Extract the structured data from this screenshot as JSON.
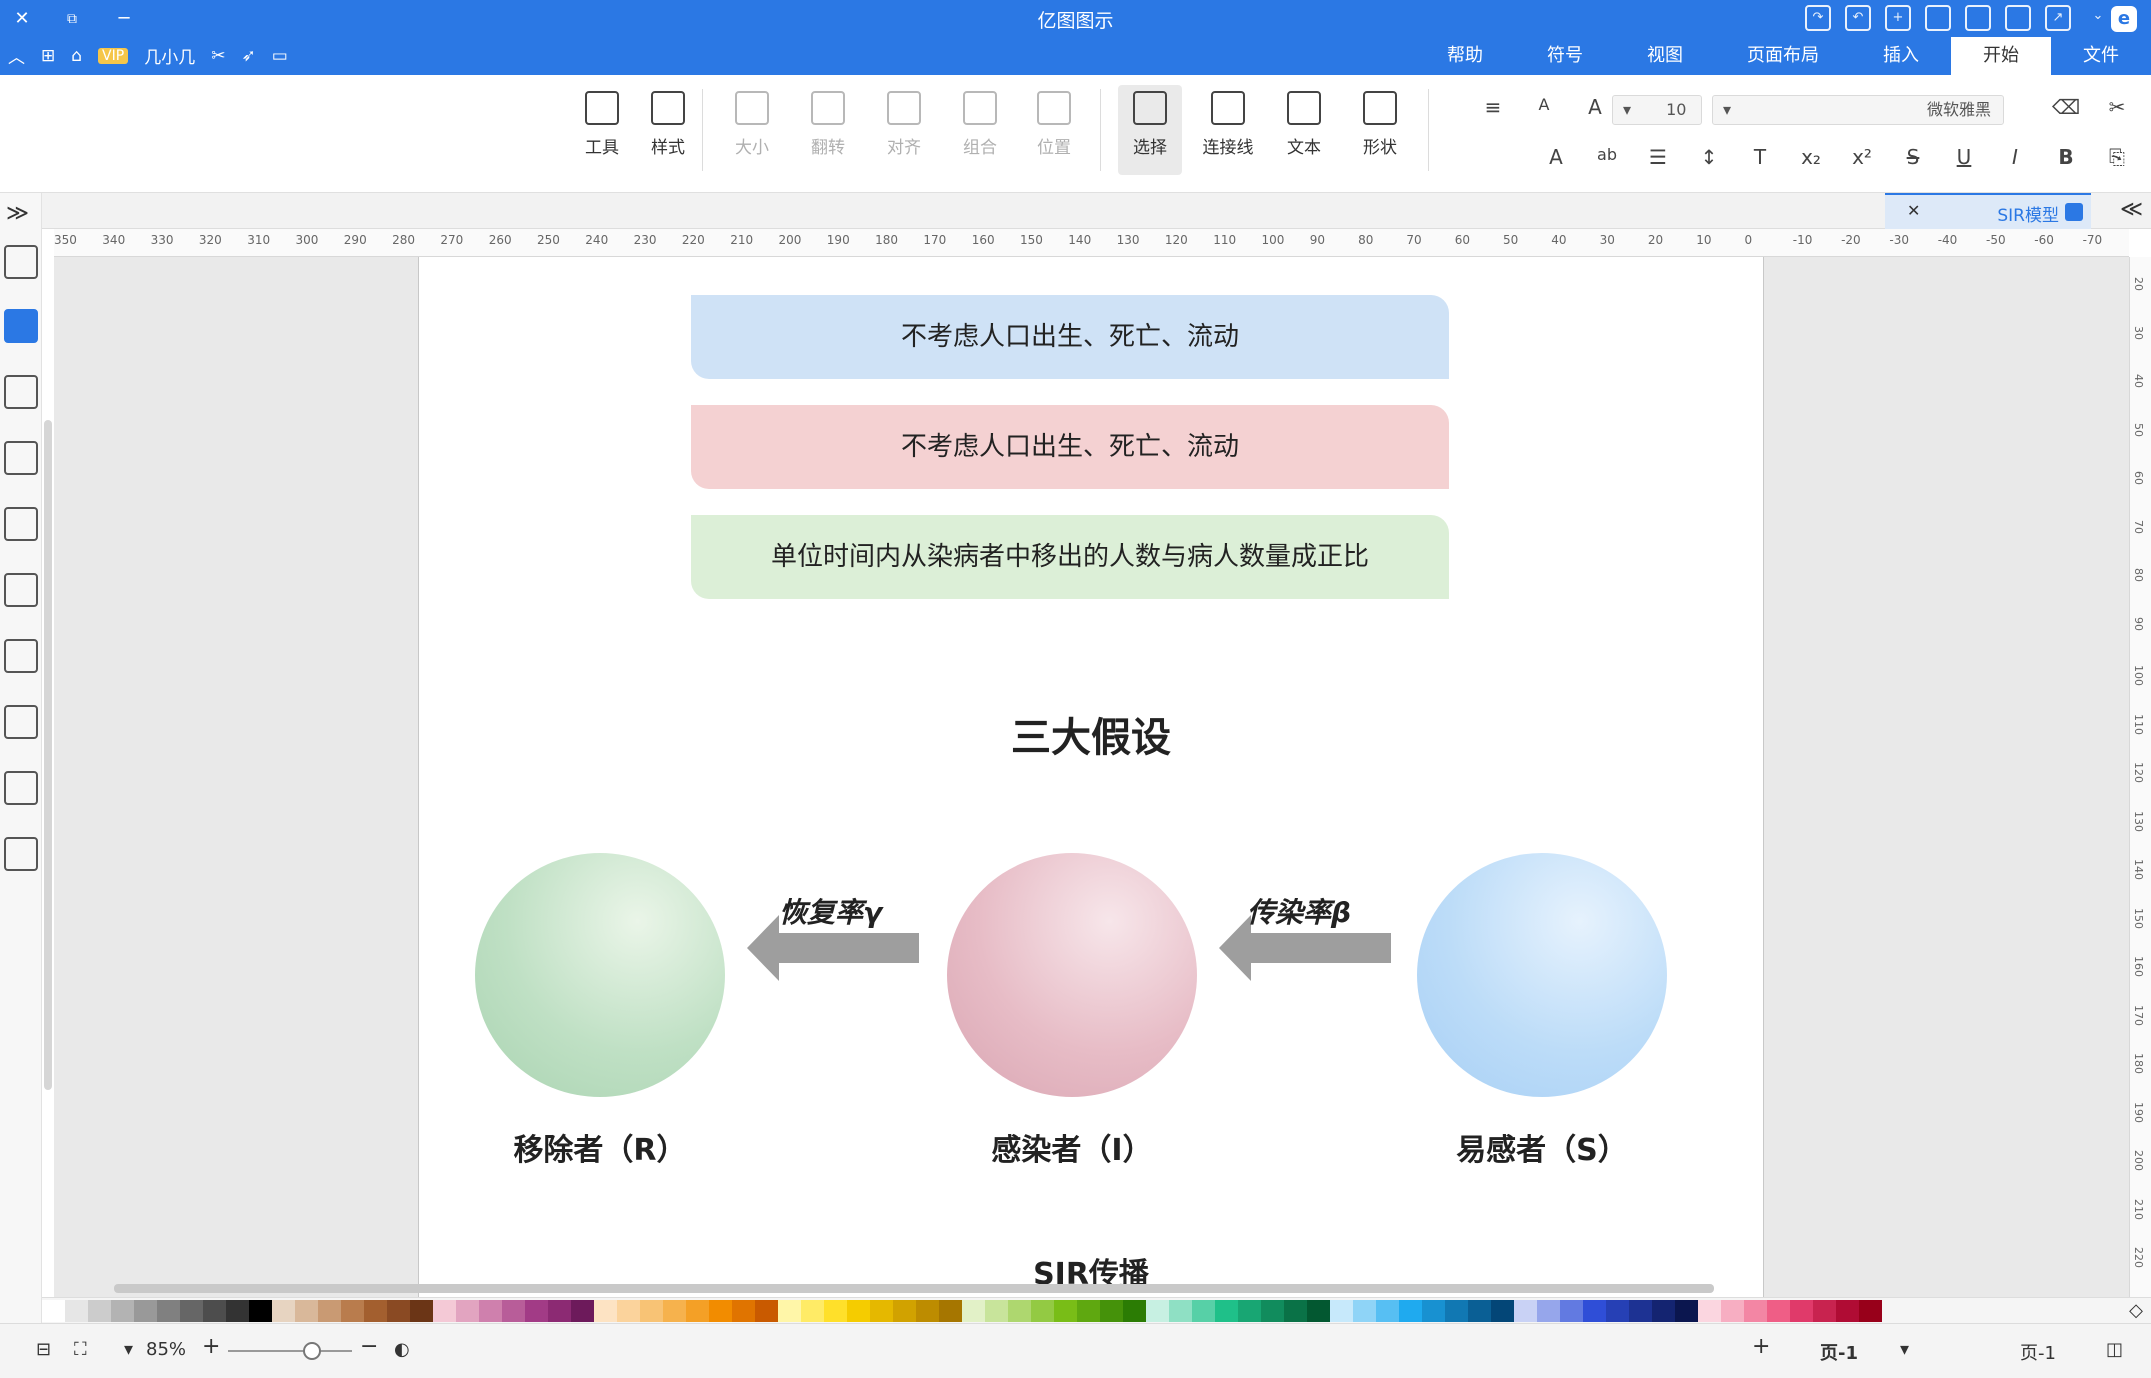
{
  "titlebar": {
    "title": "亿图图示",
    "close": "✕",
    "restore": "⧉",
    "minimize": "─",
    "logo": "e",
    "vip_label": "VIP",
    "quick_tools_label": "几小几"
  },
  "menu": {
    "tabs": [
      "文件",
      "开始",
      "插入",
      "页面布局",
      "视图",
      "符号",
      "帮助"
    ],
    "active": "开始"
  },
  "ribbon": {
    "tools": [
      {
        "label": "工具",
        "icon": "tools-icon"
      },
      {
        "label": "样式",
        "icon": "paint-bucket-icon"
      },
      {
        "label": "大小",
        "icon": "size-icon"
      },
      {
        "label": "翻转",
        "icon": "flip-icon"
      },
      {
        "label": "对齐",
        "icon": "align-icon"
      },
      {
        "label": "组合",
        "icon": "group-icon"
      },
      {
        "label": "位置",
        "icon": "layers-icon"
      },
      {
        "label": "选择",
        "icon": "select-icon"
      },
      {
        "label": "连接线",
        "icon": "connector-icon"
      },
      {
        "label": "文本",
        "icon": "text-icon"
      },
      {
        "label": "形状",
        "icon": "shape-icon"
      }
    ],
    "font_name": "微软雅黑",
    "font_size": "10",
    "format_row1": [
      "✂",
      "⌫",
      "A",
      "A",
      "≡"
    ],
    "format_row2": [
      "⎘",
      "B",
      "I",
      "U",
      "S",
      "x²",
      "x₂",
      "T",
      "↕",
      "☰",
      "ab",
      "A"
    ]
  },
  "doc_tab": {
    "label": "SIR模型",
    "close": "✕"
  },
  "diagram": {
    "box_blue": "不考虑人口出生、死亡、流动",
    "box_pink": "不考虑人口出生、死亡、流动",
    "box_green": "单位时间内从染病者中移出的人数与病人数量成正比",
    "heading": "三大假设",
    "label_r": "移除者（R）",
    "label_i": "感染者（I）",
    "label_s": "易感者（S）",
    "arrow_recovery": "恢复率γ",
    "arrow_transmission": "传染率β",
    "caption": "SIR传播"
  },
  "ruler": {
    "h_ticks": [
      "350",
      "340",
      "330",
      "320",
      "310",
      "300",
      "290",
      "280",
      "270",
      "260",
      "250",
      "240",
      "230",
      "220",
      "210",
      "200",
      "190",
      "180",
      "170",
      "160",
      "150",
      "140",
      "130",
      "120",
      "110",
      "100",
      "90",
      "80",
      "70",
      "60",
      "50",
      "40",
      "30",
      "20",
      "10",
      "0",
      "-10",
      "-20",
      "-30",
      "-40",
      "-50",
      "-60",
      "-70"
    ],
    "v_ticks": [
      "20",
      "30",
      "40",
      "50",
      "60",
      "70",
      "80",
      "90",
      "100",
      "110",
      "120",
      "130",
      "140",
      "150",
      "160",
      "170",
      "180",
      "190",
      "200",
      "210",
      "220"
    ]
  },
  "palette": {
    "colors": [
      "#ffffff",
      "#e6e6e6",
      "#cccccc",
      "#b3b3b3",
      "#999999",
      "#808080",
      "#666666",
      "#4d4d4d",
      "#333333",
      "#000000",
      "#e7d4c1",
      "#d9b89a",
      "#c99a73",
      "#b97c4d",
      "#a35f2f",
      "#8a4a23",
      "#6b3516",
      "#f4c9d6",
      "#e2a4c0",
      "#cf80ad",
      "#b85d99",
      "#a23b86",
      "#8c2a73",
      "#6d1a5b",
      "#fde3c3",
      "#fbd39c",
      "#f8c375",
      "#f6b24d",
      "#f4a026",
      "#f28c00",
      "#e07400",
      "#c95a00",
      "#fff6a8",
      "#ffeb66",
      "#ffe02a",
      "#f5cc00",
      "#e5b800",
      "#d1a200",
      "#bd8c00",
      "#a67600",
      "#e2f1c7",
      "#c8e49b",
      "#aed76f",
      "#93ca43",
      "#79bd17",
      "#5fa810",
      "#45920a",
      "#2b7c04",
      "#c7f0e2",
      "#8fe0c4",
      "#57d0a7",
      "#1fc089",
      "#18a673",
      "#118c5d",
      "#0a7247",
      "#035831",
      "#c7e9fb",
      "#8fd4f7",
      "#57bff3",
      "#1faaef",
      "#1891d1",
      "#1178b3",
      "#0a5f95",
      "#034677",
      "#c9d2f5",
      "#96a6eb",
      "#627ae1",
      "#2f4ed7",
      "#2640b5",
      "#1d3293",
      "#142471",
      "#0b164f",
      "#fbd6e0",
      "#f7aec2",
      "#f386a4",
      "#ef5e86",
      "#e03a6a",
      "#c8234f",
      "#b00c34",
      "#98001a"
    ]
  },
  "statusbar": {
    "page_label": "页-1",
    "page_tab": "页-1",
    "add_page": "+",
    "zoom": "85%",
    "zoom_in": "+",
    "zoom_out": "−",
    "zoom_level": 0.68
  }
}
